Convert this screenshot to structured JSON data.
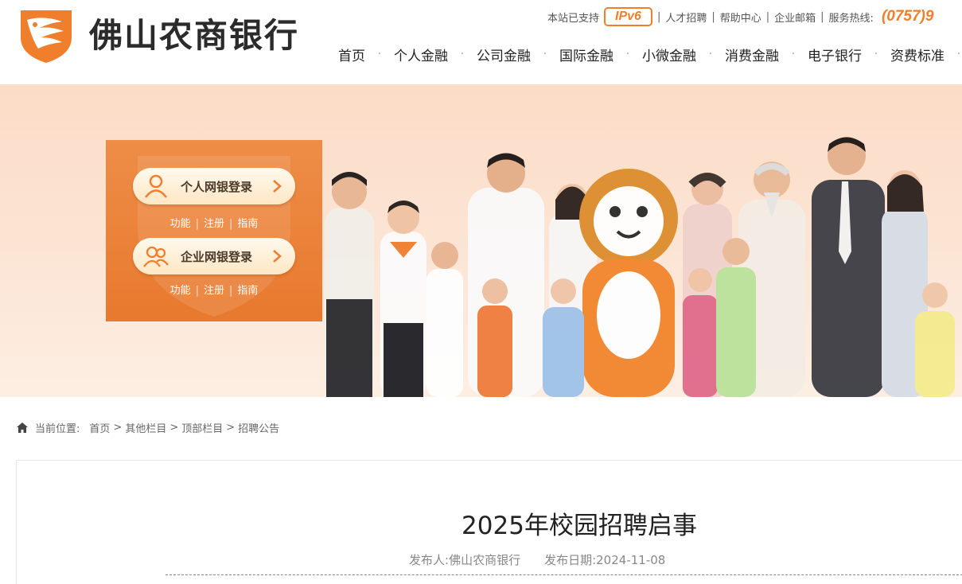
{
  "header": {
    "logo_text": "佛山农商银行",
    "topbar": {
      "ipv6_prefix": "本站已支持",
      "ipv6_badge": "IPv6",
      "links": [
        "人才招聘",
        "帮助中心",
        "企业邮箱"
      ],
      "hotline_label": "服务热线:",
      "hotline_number": "(0757)9"
    },
    "nav": [
      "首页",
      "个人金融",
      "公司金融",
      "国际金融",
      "小微金融",
      "消费金融",
      "电子银行",
      "资费标准"
    ]
  },
  "banner": {
    "personal_login": "个人网银登录",
    "enterprise_login": "企业网银登录",
    "sublinks": [
      "功能",
      "注册",
      "指南"
    ]
  },
  "breadcrumb": {
    "label": "当前位置:",
    "items": [
      "首页",
      "其他栏目",
      "顶部栏目",
      "招聘公告"
    ]
  },
  "article": {
    "title": "2025年校园招聘启事",
    "publisher_label": "发布人:",
    "publisher": "佛山农商银行",
    "date_label": "发布日期:",
    "date": "2024-11-08"
  },
  "colors": {
    "brand_orange": "#ef7e2d",
    "login_panel": "#ec8640",
    "banner_bg": "#fce3d2"
  }
}
